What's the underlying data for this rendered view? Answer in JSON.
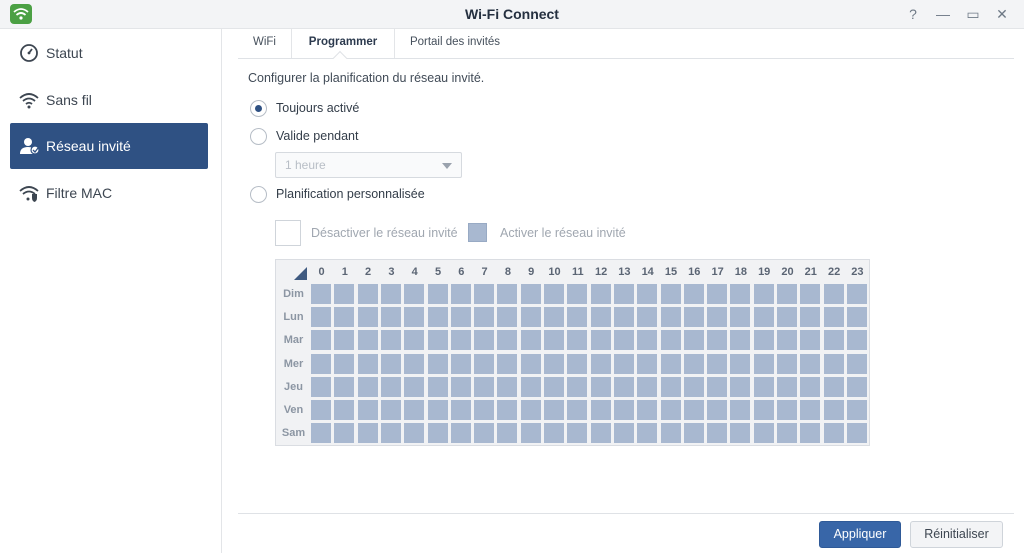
{
  "window": {
    "title": "Wi-Fi Connect",
    "help": "?",
    "minimize": "—",
    "maximize": "▭",
    "close": "✕"
  },
  "sidebar": {
    "items": [
      {
        "label": "Statut",
        "icon": "gauge-icon"
      },
      {
        "label": "Sans fil",
        "icon": "wifi-icon"
      },
      {
        "label": "Réseau invité",
        "icon": "guest-user-icon",
        "active": true
      },
      {
        "label": "Filtre MAC",
        "icon": "wifi-shield-icon"
      }
    ]
  },
  "tabs": [
    {
      "label": "WiFi"
    },
    {
      "label": "Programmer",
      "active": true
    },
    {
      "label": "Portail des invités"
    }
  ],
  "schedule": {
    "description": "Configurer la planification du réseau invité.",
    "always_on": "Toujours activé",
    "valid_for": "Valide pendant",
    "duration_value": "1 heure",
    "custom": "Planification personnalisée",
    "legend_off": "Désactiver le réseau invité",
    "legend_on": "Activer le réseau invité",
    "hours": [
      "0",
      "1",
      "2",
      "3",
      "4",
      "5",
      "6",
      "7",
      "8",
      "9",
      "10",
      "11",
      "12",
      "13",
      "14",
      "15",
      "16",
      "17",
      "18",
      "19",
      "20",
      "21",
      "22",
      "23"
    ],
    "days": [
      "Dim",
      "Lun",
      "Mar",
      "Mer",
      "Jeu",
      "Ven",
      "Sam"
    ],
    "all_cells_enabled": true,
    "enabled_color": "#a8b8d0"
  },
  "footer": {
    "apply": "Appliquer",
    "reset": "Réinitialiser"
  },
  "colors": {
    "accent": "#2f5183",
    "primary_button": "#3866a8",
    "app_icon": "#4ba044"
  }
}
